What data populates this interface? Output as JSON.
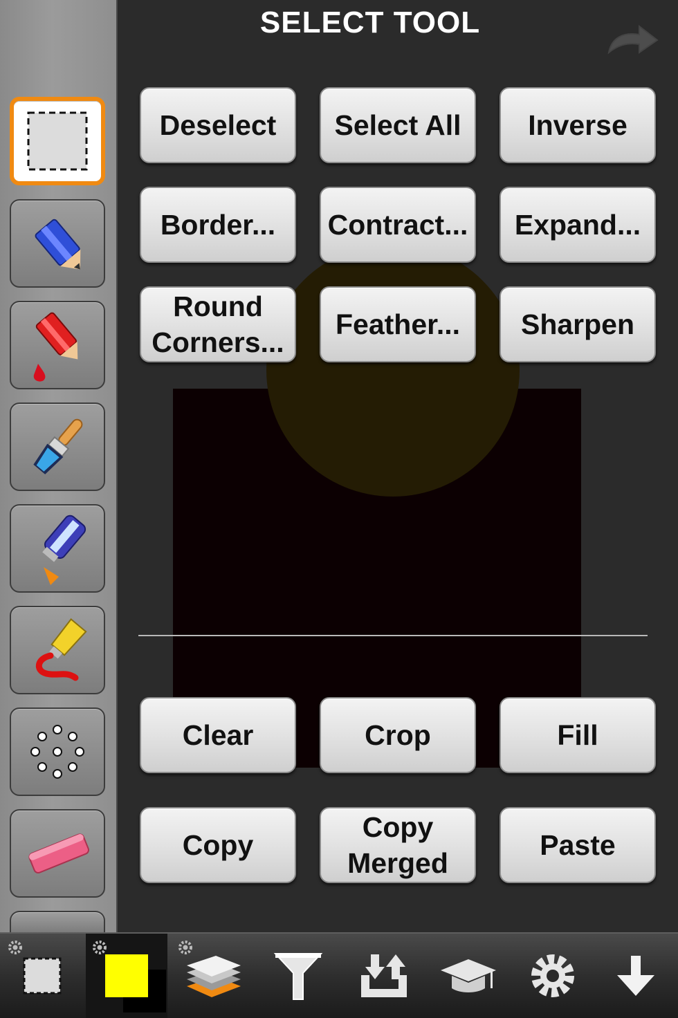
{
  "header": {
    "title": "SELECT TOOL"
  },
  "actions": {
    "deselect": "Deselect",
    "select_all": "Select All",
    "inverse": "Inverse",
    "border": "Border...",
    "contract": "Contract...",
    "expand": "Expand...",
    "round_corners": "Round\nCorners...",
    "feather": "Feather...",
    "sharpen": "Sharpen",
    "clear": "Clear",
    "crop": "Crop",
    "fill": "Fill",
    "copy": "Copy",
    "copy_merged": "Copy\nMerged",
    "paste": "Paste"
  },
  "tools": [
    "selection-tool",
    "pencil-tool",
    "color-pencil-tool",
    "brush-tool",
    "airbrush-tool",
    "paint-tube-tool",
    "dots-tool",
    "eraser-tool"
  ],
  "colors": {
    "accent": "#f08a12",
    "current_color": "#ffff00",
    "canvas_bg": "#0c0002",
    "circle": "#241c04"
  },
  "bottom_bar": [
    "selection-options-icon",
    "color-swatch",
    "layers-icon",
    "filter-icon",
    "import-export-icon",
    "tutorial-icon",
    "settings-icon",
    "download-icon"
  ]
}
